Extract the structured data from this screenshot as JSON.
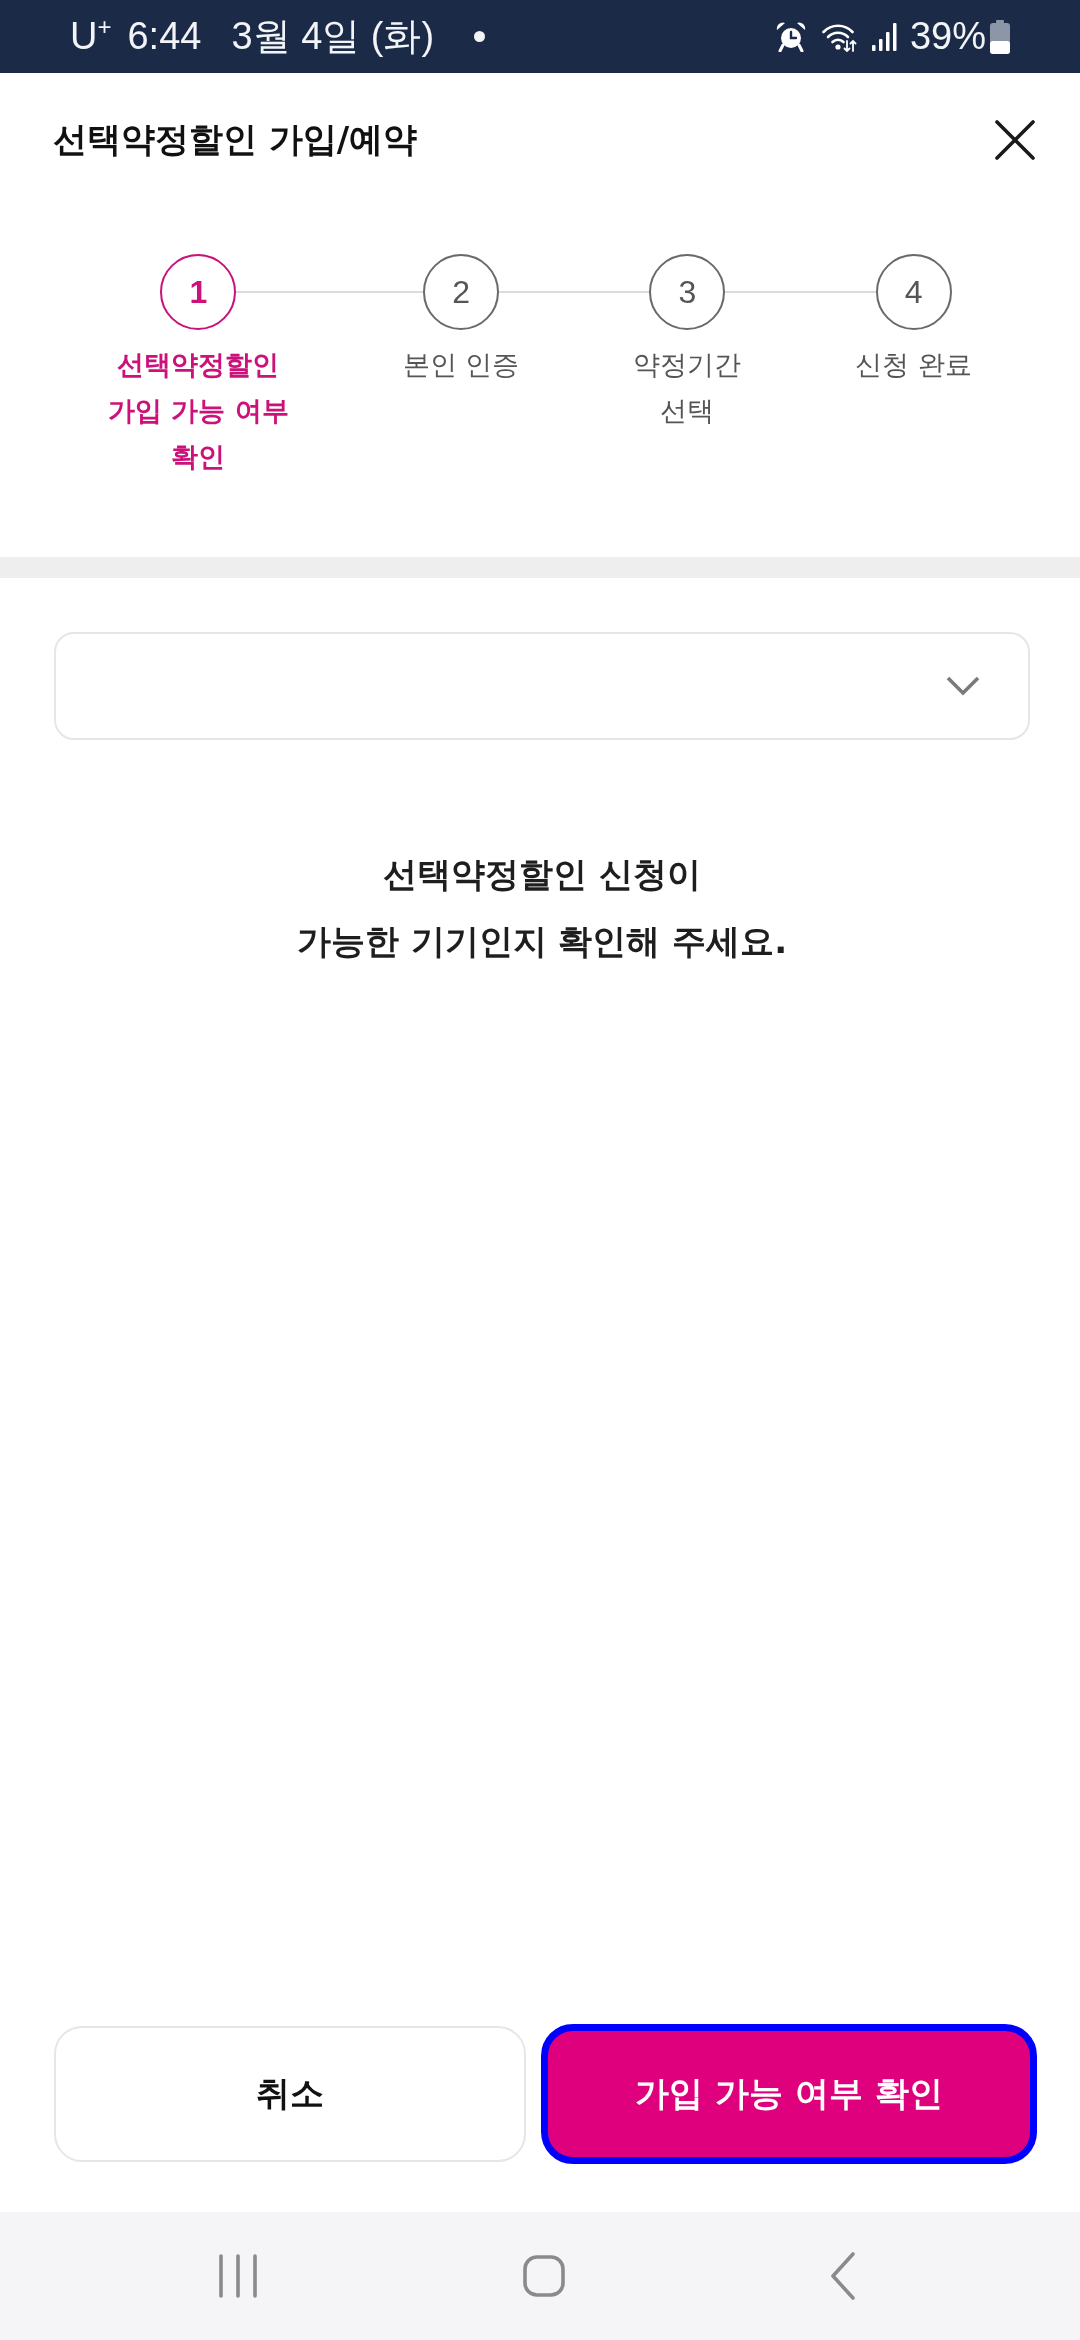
{
  "status_bar": {
    "carrier": "U$^{+}$",
    "time": "6:44",
    "date": "3월 4일 (화)",
    "battery": "39%"
  },
  "header": {
    "title": "선택약정할인 가입/예약"
  },
  "steps": [
    {
      "number": "1",
      "label": "선택약정할인\n가입 가능 여부\n확인",
      "selected": true
    },
    {
      "number": "2",
      "label": "본인 인증",
      "selected": false
    },
    {
      "number": "3",
      "label": "약정기간\n선택",
      "selected": false
    },
    {
      "number": "4",
      "label": "신청 완료",
      "selected": false
    }
  ],
  "message": "선택약정할인 신청이\n가능한 기기인지 확인해 주세요.",
  "buttons": [
    {
      "label": "취소",
      "kind": "secondary",
      "focused": false
    },
    {
      "label": "가입 가능 여부 확인",
      "kind": "primary",
      "focused": true
    }
  ]
}
